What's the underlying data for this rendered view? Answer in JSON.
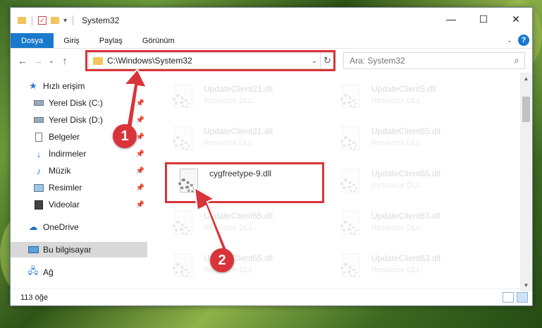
{
  "window": {
    "title": "System32",
    "controls": {
      "minimize": "—",
      "maximize": "☐",
      "close": "✕"
    }
  },
  "ribbon": {
    "tabs": [
      "Dosya",
      "Giriş",
      "Paylaş",
      "Görünüm"
    ],
    "active_tab": "Dosya",
    "help": "?"
  },
  "navigation": {
    "back": "←",
    "forward": "→",
    "recent": "⌄",
    "up": "↑",
    "address": "C:\\Windows\\System32",
    "search_placeholder": "Ara: System32"
  },
  "sidebar": {
    "items": [
      {
        "label": "Hızlı erişim",
        "icon": "star-icon"
      },
      {
        "label": "Yerel Disk (C:)",
        "icon": "drive-icon",
        "pinned": true
      },
      {
        "label": "Yerel Disk (D:)",
        "icon": "drive-icon",
        "pinned": true
      },
      {
        "label": "Belgeler",
        "icon": "document-icon",
        "pinned": true
      },
      {
        "label": "İndirmeler",
        "icon": "download-icon",
        "pinned": true
      },
      {
        "label": "Müzik",
        "icon": "music-icon",
        "pinned": true
      },
      {
        "label": "Resimler",
        "icon": "picture-icon",
        "pinned": true
      },
      {
        "label": "Videolar",
        "icon": "video-icon",
        "pinned": true
      },
      {
        "label": "OneDrive",
        "icon": "cloud-icon"
      },
      {
        "label": "Bu bilgisayar",
        "icon": "computer-icon",
        "selected": true
      },
      {
        "label": "Ağ",
        "icon": "network-icon"
      }
    ]
  },
  "files": [
    {
      "name": "UpdateClient21.dll",
      "desc": "Resource DLL"
    },
    {
      "name": "UpdateClient5.dll",
      "desc": "Resource DLL"
    },
    {
      "name": "UpdateClient21.dll",
      "desc": "Resource DLL"
    },
    {
      "name": "UpdateClient65.dll",
      "desc": "Resource DLL"
    },
    {
      "name": "cygfreetype-9.dll",
      "desc": "",
      "highlighted": true
    },
    {
      "name": "UpdateClient65.dll",
      "desc": "Resource DLL"
    },
    {
      "name": "UpdateClient65.dll",
      "desc": "Resource DLL"
    },
    {
      "name": "UpdateClient63.dll",
      "desc": "Resource DLL"
    },
    {
      "name": "UpdateClient65.dll",
      "desc": "Resource DLL"
    },
    {
      "name": "UpdateClient63.dll",
      "desc": "Resource DLL"
    }
  ],
  "status": {
    "item_count": "113 öğe"
  },
  "annotations": {
    "step1": "1",
    "step2": "2",
    "color": "#d9343a"
  }
}
